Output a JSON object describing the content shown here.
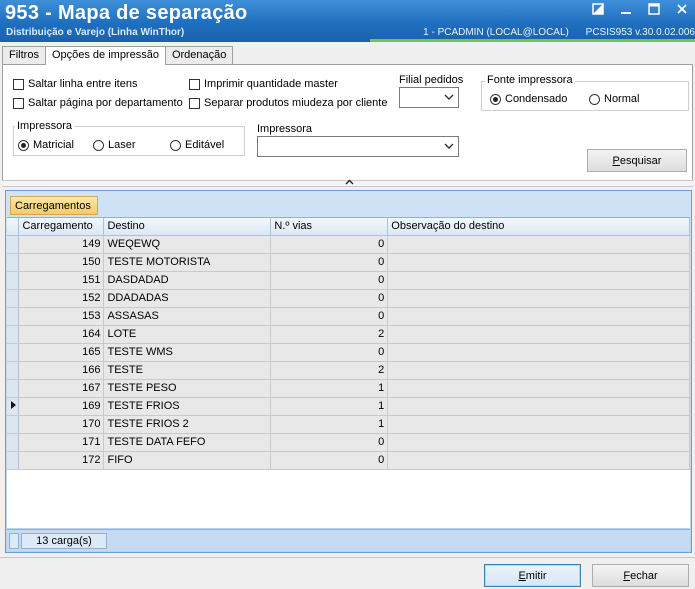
{
  "window": {
    "title": "953 - Mapa de separação",
    "subtitle": "Distribuição e Varejo (Linha WinThor)",
    "session": "1 - PCADMIN (LOCAL@LOCAL)",
    "version": "PCSIS953  v.30.0.02.006"
  },
  "tabs": [
    {
      "label": "Filtros",
      "active": false
    },
    {
      "label": "Opções de impressão",
      "active": true
    },
    {
      "label": "Ordenação",
      "active": false
    }
  ],
  "options": {
    "saltar_linha": {
      "label": "Saltar linha entre itens",
      "checked": false
    },
    "saltar_pagina": {
      "label": "Saltar página por departamento",
      "checked": false
    },
    "imprimir_qtd_master": {
      "label": "Imprimir quantidade master",
      "checked": false
    },
    "separar_miudeza": {
      "label": "Separar produtos miudeza por cliente",
      "checked": false
    },
    "filial_pedidos_label": "Filial pedidos",
    "filial_pedidos_value": "",
    "fonte_label": "Fonte impressora",
    "fonte_options": [
      {
        "label": "Condensado",
        "selected": true
      },
      {
        "label": "Normal",
        "selected": false
      }
    ],
    "impressora_group_label": "Impressora",
    "impressora_types": [
      {
        "label": "Matricial",
        "selected": true
      },
      {
        "label": "Laser",
        "selected": false
      },
      {
        "label": "Editável",
        "selected": false
      }
    ],
    "impressora_select_label": "Impressora",
    "impressora_select_value": "",
    "pesquisar_label": "Pesquisar"
  },
  "grid": {
    "tab_label": "Carregamentos",
    "columns": [
      "Carregamento",
      "Destino",
      "N.º vias",
      "Observação do destino"
    ],
    "rows": [
      {
        "carregamento": "149",
        "destino": "WEQEWQ",
        "vias": "0",
        "obs": "",
        "current": false
      },
      {
        "carregamento": "150",
        "destino": "TESTE MOTORISTA",
        "vias": "0",
        "obs": "",
        "current": false
      },
      {
        "carregamento": "151",
        "destino": "DASDADAD",
        "vias": "0",
        "obs": "",
        "current": false
      },
      {
        "carregamento": "152",
        "destino": "DDADADAS",
        "vias": "0",
        "obs": "",
        "current": false
      },
      {
        "carregamento": "153",
        "destino": "ASSASAS",
        "vias": "0",
        "obs": "",
        "current": false
      },
      {
        "carregamento": "164",
        "destino": "LOTE",
        "vias": "2",
        "obs": "",
        "current": false
      },
      {
        "carregamento": "165",
        "destino": "TESTE WMS",
        "vias": "0",
        "obs": "",
        "current": false
      },
      {
        "carregamento": "166",
        "destino": "TESTE",
        "vias": "2",
        "obs": "",
        "current": false
      },
      {
        "carregamento": "167",
        "destino": "TESTE PESO",
        "vias": "1",
        "obs": "",
        "current": false
      },
      {
        "carregamento": "169",
        "destino": "TESTE FRIOS",
        "vias": "1",
        "obs": "",
        "current": true
      },
      {
        "carregamento": "170",
        "destino": "TESTE FRIOS 2",
        "vias": "1",
        "obs": "",
        "current": false
      },
      {
        "carregamento": "171",
        "destino": "TESTE DATA FEFO",
        "vias": "0",
        "obs": "",
        "current": false
      },
      {
        "carregamento": "172",
        "destino": "FIFO",
        "vias": "0",
        "obs": "",
        "current": false
      }
    ],
    "footer_count": "13 carga(s)"
  },
  "actions": {
    "emitir": "Emitir",
    "fechar": "Fechar"
  },
  "colors": {
    "title_bar": "#1f6fc0",
    "accent_green": "#7cc142",
    "grid_tab": "#f7c964"
  }
}
